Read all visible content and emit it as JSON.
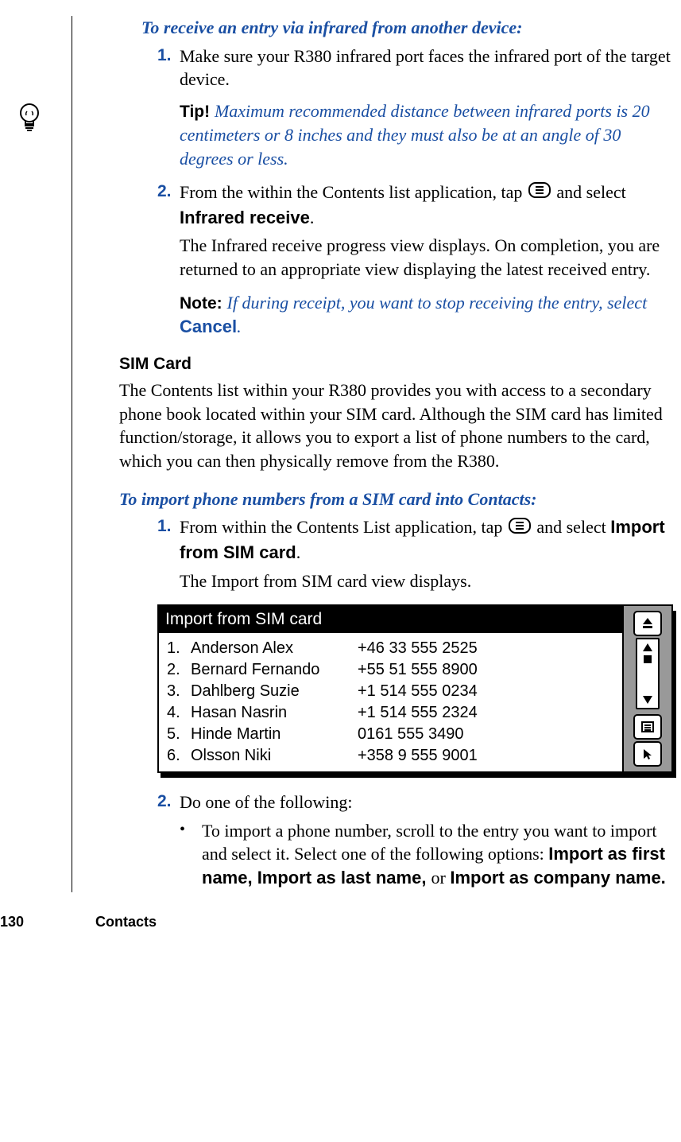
{
  "receive": {
    "heading": "To receive an entry via infrared from another device:",
    "step1": "Make sure your R380 infrared port faces the infrared port of the target device.",
    "tip_label": "Tip! ",
    "tip_text": "Maximum recommended distance between infrared ports is 20 centimeters or 8 inches and they must also be at an angle of 30 degrees or less.",
    "step2a": "From the within the Contents list application, tap ",
    "step2b": " and select ",
    "step2_menu": "Infrared receive",
    "step2_tail": ".",
    "sub2": "The Infrared receive progress view displays. On completion, you are returned to an appropriate view displaying the latest received entry.",
    "note_label": "Note: ",
    "note_text_a": "If during receipt, you want to stop receiving the entry, select ",
    "note_cancel": "Cancel",
    "note_text_b": "."
  },
  "sim": {
    "title": "SIM Card",
    "para": "The Contents list within your R380 provides you with access to a secondary phone book located within your SIM card. Although the SIM card has limited function/storage, it allows you to export a list of phone numbers to the card, which you can then physically remove from the R380."
  },
  "import": {
    "heading": "To import phone numbers from a SIM card into Contacts:",
    "step1a": "From within the Contents List application, tap ",
    "step1b": " and select ",
    "step1_menu": "Import from SIM card",
    "step1_tail": ".",
    "sub1": "The Import from SIM card view displays."
  },
  "simbox": {
    "title": "Import from SIM card",
    "rows": [
      {
        "idx": "1.",
        "name": "Anderson Alex",
        "phone": "+46 33 555 2525"
      },
      {
        "idx": "2.",
        "name": "Bernard Fernando",
        "phone": "+55 51 555 8900"
      },
      {
        "idx": "3.",
        "name": "Dahlberg Suzie",
        "phone": "+1 514 555 0234"
      },
      {
        "idx": "4.",
        "name": "Hasan Nasrin",
        "phone": "+1 514 555 2324"
      },
      {
        "idx": "5.",
        "name": "Hinde Martin",
        "phone": "0161 555 3490"
      },
      {
        "idx": "6.",
        "name": "Olsson Niki",
        "phone": "+358 9 555 9001"
      }
    ]
  },
  "import2": {
    "step2": "Do one of the following:",
    "bullet_a": "To import a phone number, scroll to the entry you want to import and select it. Select one of the following options: ",
    "opt1": "Import as first name,  Import as last name, ",
    "or": "or ",
    "opt3": "Import as company name."
  },
  "footer": {
    "page": "130",
    "section": "Contacts"
  }
}
